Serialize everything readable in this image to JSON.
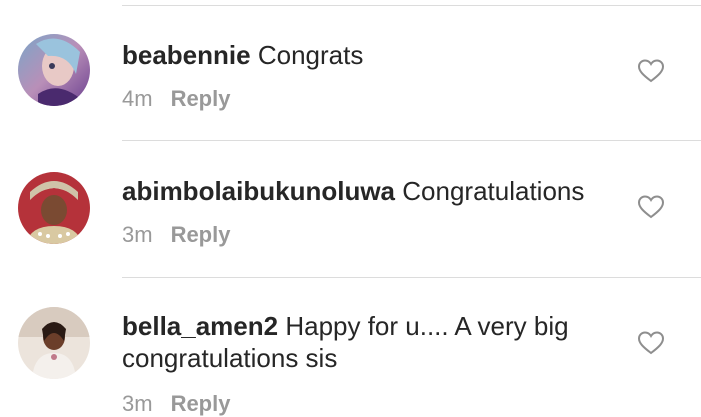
{
  "comments": [
    {
      "username": "beabennie",
      "text": "Congrats",
      "time": "4m",
      "reply_label": "Reply",
      "like_icon": "heart-outline-icon"
    },
    {
      "username": "abimbolaibukunoluwa",
      "text": "Congratulations",
      "time": "3m",
      "reply_label": "Reply",
      "like_icon": "heart-outline-icon"
    },
    {
      "username": "bella_amen2",
      "text": "Happy for u.... A very big congratulations sis",
      "time": "3m",
      "reply_label": "Reply",
      "like_icon": "heart-outline-icon"
    }
  ],
  "colors": {
    "text": "#262626",
    "secondary": "#999999",
    "divider": "#dcdcdc"
  }
}
